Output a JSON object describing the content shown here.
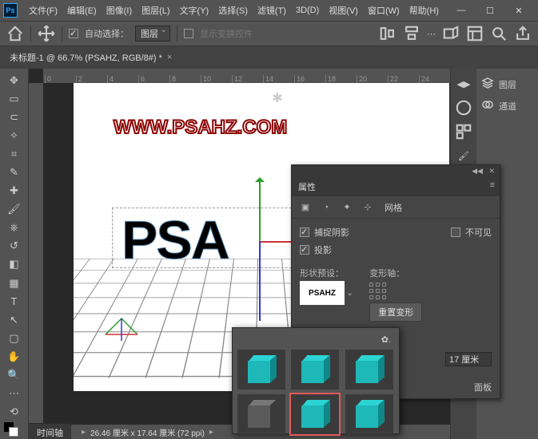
{
  "menu": [
    "文件(F)",
    "编辑(E)",
    "图像(I)",
    "图层(L)",
    "文字(Y)",
    "选择(S)",
    "滤镜(T)",
    "3D(D)",
    "视图(V)",
    "窗口(W)",
    "帮助(H)"
  ],
  "toolbar": {
    "auto_select_label": "自动选择：",
    "auto_select_value": "图层",
    "show_transform_label": "显示变换控件"
  },
  "tab": {
    "title": "未标题-1 @ 66.7% (PSAHZ, RGB/8#) *"
  },
  "ruler": [
    "0",
    "2",
    "4",
    "6",
    "8",
    "10",
    "12",
    "14",
    "16",
    "18",
    "20",
    "22",
    "24"
  ],
  "canvas": {
    "watermark": "WWW.PSAHZ.COM",
    "text3d": "PSA",
    "statusbar": "26.46 厘米 x 17.64 厘米 (72 ppi)"
  },
  "right": {
    "panels": [
      {
        "icon": "layers-icon",
        "label": "图层"
      },
      {
        "icon": "channels-icon",
        "label": "通道"
      }
    ]
  },
  "properties": {
    "title": "属性",
    "mesh_tab": "网格",
    "catch_shadow": "捕捉阴影",
    "invisible": "不可见",
    "cast_shadow": "投影",
    "shape_preset": "形状预设：",
    "deform_axis": "变形轴：",
    "preset_text": "PSAHZ",
    "reset_deform": "重置变形",
    "dim_value": "17 厘米",
    "panel_btn": "面板"
  },
  "timeline": {
    "label": "时间轴"
  }
}
